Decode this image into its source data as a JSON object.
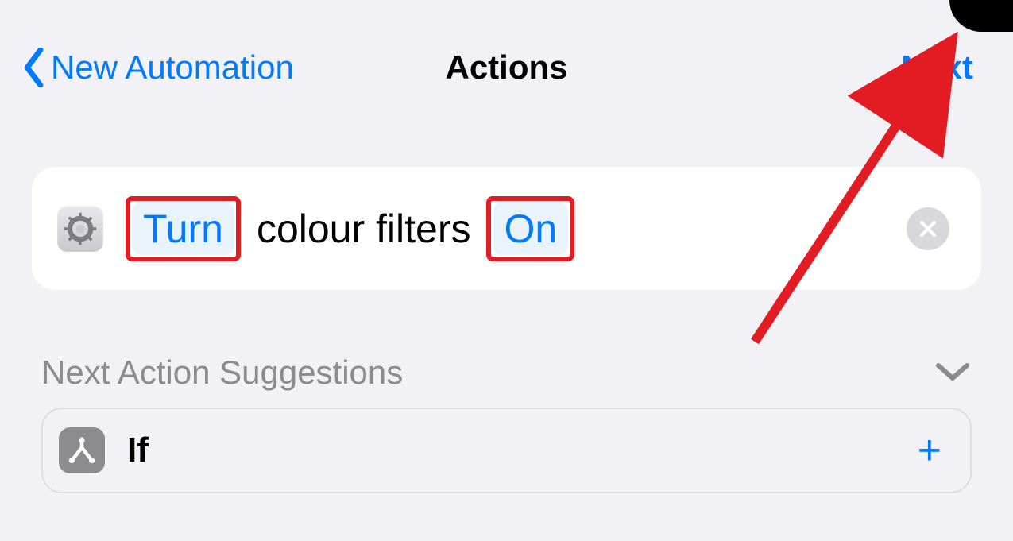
{
  "nav": {
    "back_label": "New Automation",
    "title": "Actions",
    "next_label": "Next"
  },
  "action": {
    "icon": "settings-gear-icon",
    "token1": "Turn",
    "middle": "colour filters",
    "token2": "On"
  },
  "suggestions": {
    "header": "Next Action Suggestions",
    "items": [
      {
        "icon": "branch-icon",
        "label": "If"
      }
    ]
  },
  "colors": {
    "ios_blue": "#007aff",
    "annotation_red": "#e31b23"
  }
}
